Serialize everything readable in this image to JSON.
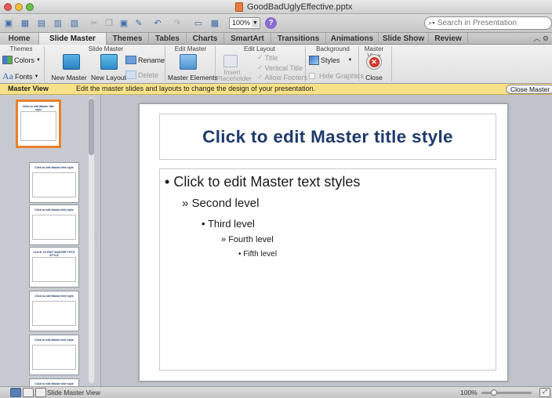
{
  "window": {
    "title": "GoodBadUglyEffective.pptx"
  },
  "toolbar": {
    "zoom": "100%",
    "search_placeholder": "Search in Presentation"
  },
  "tabs": [
    {
      "label": "Home",
      "w": 50
    },
    {
      "label": "Slide Master",
      "w": 86
    },
    {
      "label": "Themes",
      "w": 54
    },
    {
      "label": "Tables",
      "w": 48
    },
    {
      "label": "Charts",
      "w": 48
    },
    {
      "label": "SmartArt",
      "w": 60
    },
    {
      "label": "Transitions",
      "w": 70
    },
    {
      "label": "Animations",
      "w": 67
    },
    {
      "label": "Slide Show",
      "w": 64
    },
    {
      "label": "Review",
      "w": 50
    }
  ],
  "ribbon": {
    "groups": {
      "themes": "Themes",
      "slide_master": "Slide Master",
      "edit_master": "Edit Master",
      "edit_layout": "Edit Layout",
      "background": "Background",
      "master_view": "Master View"
    },
    "colors": "Colors",
    "fonts": "Fonts",
    "new_master": "New Master",
    "new_layout": "New Layout",
    "rename": "Rename",
    "delete": "Delete",
    "master_elements": "Master Elements",
    "insert_placeholder": "Insert\nPlaceholder",
    "title": "Title",
    "vertical_title": "Vertical Title",
    "allow_footers": "Allow Footers",
    "styles": "Styles",
    "hide_graphics": "Hide Graphics",
    "close": "Close"
  },
  "master_bar": {
    "label": "Master View",
    "message": "Edit the master slides and layouts to change the design of your presentation.",
    "close_button": "Close Master"
  },
  "slide": {
    "title": "Click to edit Master title style",
    "levels": [
      {
        "bullet": "•",
        "text": "Click to edit Master text styles"
      },
      {
        "bullet": "»",
        "text": "Second level"
      },
      {
        "bullet": "•",
        "text": "Third level"
      },
      {
        "bullet": "»",
        "text": "Fourth level"
      },
      {
        "bullet": "•",
        "text": "Fifth level"
      }
    ]
  },
  "thumbnails": [
    {
      "title": "Click to edit Master title style"
    },
    {
      "title": "Click to edit Master title style"
    },
    {
      "title": "Click to edit Master title style"
    },
    {
      "title": "CLICK TO EDIT MASTER TITLE STYLE"
    },
    {
      "title": "Click to edit Master title style"
    },
    {
      "title": "Click to edit Master title style"
    },
    {
      "title": "Click to edit Master title style"
    }
  ],
  "status": {
    "view_label": "Slide Master View",
    "zoom": "100%"
  },
  "colors": {
    "title_blue": "#1f3a6b",
    "master_bar": "#f8e289",
    "selection_orange": "#e8802c"
  }
}
